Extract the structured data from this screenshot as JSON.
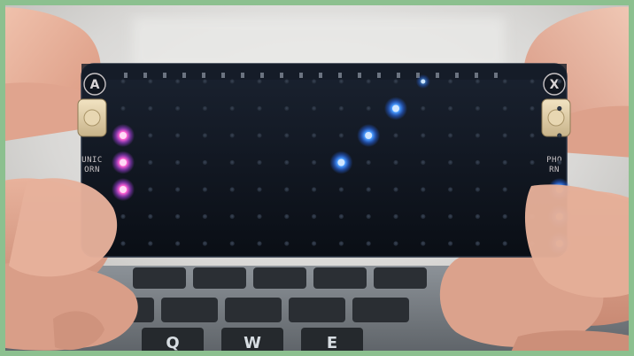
{
  "photo": {
    "board": {
      "button_left_letter": "A",
      "button_right_letter": "X",
      "silk_left": [
        "UNIC",
        "ORN"
      ],
      "silk_right": [
        "PHO",
        "RN"
      ]
    },
    "keyboard": {
      "keys": [
        "Q",
        "W",
        "E"
      ]
    },
    "colors": {
      "background_frame": "#8cc08f",
      "board": "#0d1119",
      "led_off": "#2c3544",
      "led_red_purple": "#ff5ccd",
      "led_blue": "#3b8dff",
      "skin": "#e2a992"
    },
    "leds": {
      "rows": 7,
      "cols": 17,
      "lit": [
        {
          "row": 0,
          "col": 11,
          "color": "blue",
          "dim": true
        },
        {
          "row": 1,
          "col": 10,
          "color": "blue"
        },
        {
          "row": 2,
          "col": 9,
          "color": "blue"
        },
        {
          "row": 3,
          "col": 8,
          "color": "blue"
        },
        {
          "row": 2,
          "col": 0,
          "color": "pink"
        },
        {
          "row": 3,
          "col": 0,
          "color": "pink"
        },
        {
          "row": 4,
          "col": 0,
          "color": "pink"
        },
        {
          "row": 4,
          "col": 16,
          "color": "blue"
        },
        {
          "row": 5,
          "col": 16,
          "color": "blue"
        },
        {
          "row": 6,
          "col": 16,
          "color": "blue"
        }
      ]
    }
  }
}
